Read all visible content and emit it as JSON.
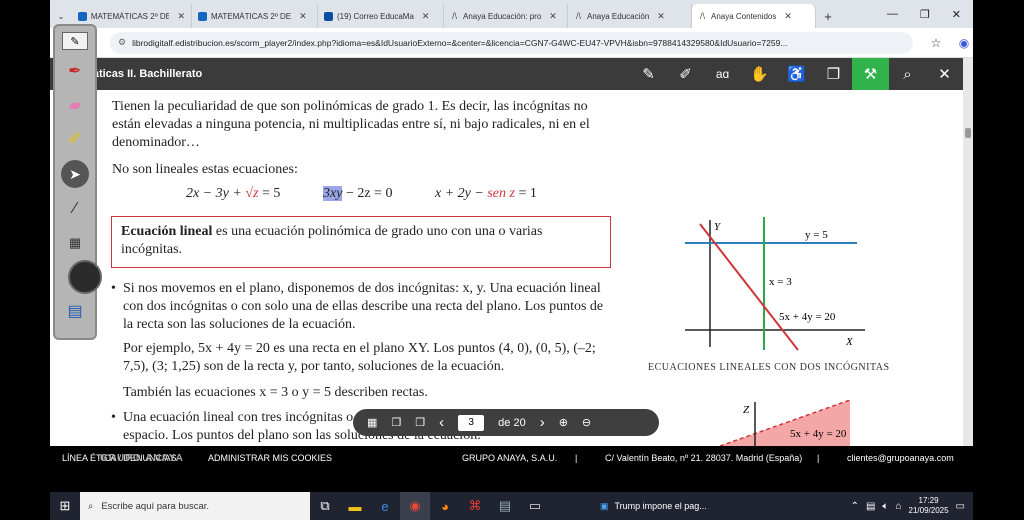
{
  "tabs": [
    {
      "label": "MATEMÁTICAS 2º DE",
      "icon": "hat-icon",
      "active": false
    },
    {
      "label": "MATEMÁTICAS 2º DE",
      "icon": "hat-icon",
      "active": false
    },
    {
      "label": "(19) Correo EducaMa",
      "icon": "mail-icon",
      "active": false
    },
    {
      "label": "Anaya Educación: pro",
      "icon": "anaya-icon",
      "active": false
    },
    {
      "label": "Anaya Educación",
      "icon": "anaya-icon",
      "active": false
    },
    {
      "label": "Anaya Contenidos",
      "icon": "anaya-icon",
      "active": true
    }
  ],
  "address": {
    "url": "librodigitalf.edistribucion.es/scorm_player2/index.php?idioma=es&IdUsuarioExterno=&center=&licencia=CGN7-G4WC-EU47-VPVH&isbn=9788414329580&IdUsuario=7259..."
  },
  "reader": {
    "title": "Matemáticas II. Bachillerato",
    "tools": [
      "pencil-icon",
      "marker-icon",
      "text-size-icon",
      "hand-icon",
      "accessibility-icon",
      "book-icon",
      "wrench-icon",
      "search-icon",
      "close-icon"
    ],
    "tool_text_size": "aɑ"
  },
  "content": {
    "para1": "Tienen la peculiaridad de que son polinómicas de grado 1. Es decir, las incógnitas no están elevadas a ninguna potencia, ni multiplicadas entre sí, ni bajo radicales, ni en el denominador…",
    "para2": "No son lineales estas ecuaciones:",
    "eq1_a": "2x − 3y + ",
    "eq1_red": "√z",
    "eq1_b": " = 5",
    "eq2_hl": "3xy",
    "eq2_b": " − 2z = 0",
    "eq3_a": "x + 2y − ",
    "eq3_red": "sen z",
    "eq3_b": " = 1",
    "def_term": "Ecuación lineal",
    "def_text": " es una ecuación polinómica de grado uno con una o varias incógnitas.",
    "bullet1": "Si nos movemos en el plano, disponemos de dos incógnitas:  x,  y.  Una ecuación lineal con dos incógnitas o con solo una de ellas describe una recta del plano. Los puntos de la recta son las soluciones de la ecuación.",
    "para3": "Por ejemplo,  5x + 4y = 20  es una recta en el plano  XY.  Los puntos (4, 0), (0, 5), (–2; 7,5), (3; 1,25) son de la recta y, por tanto, soluciones de la ecuación.",
    "para4": "También las ecuaciones  x = 3  o  y = 5  describen rectas.",
    "bullet2": "Una ecuación lineal con tres incógnitas o con alguna de ellas representa un plano en el espacio. Los puntos del plano son las soluciones de la ecuación.",
    "bullet_mark": "•",
    "caption": "Ecuaciones lineales con dos incógnitas",
    "graph": {
      "y_axis": "Y",
      "x_axis": "X",
      "label_y5": "y = 5",
      "label_x3": "x = 3",
      "label_line": "5x + 4y = 20"
    },
    "graph2": {
      "z_axis": "Z",
      "label_plane": "5x + 4y = 20"
    }
  },
  "pager": {
    "page": "3",
    "of_label": "de 20"
  },
  "footer": {
    "ethics": "LÍNEA ÉTICA / DENUNCIAS",
    "cookies": "ADMINISTRAR MIS COOKIES",
    "group": "GRUPO ANAYA, S.A.U.",
    "sep": "|",
    "address": "C/ Valentín Beato, nº 21. 28037. Madrid (España)",
    "email": "clientes@grupoanaya.com",
    "logo": "GRUPO ANAYA"
  },
  "taskbar": {
    "search_placeholder": "Escribe aquí para buscar.",
    "news": "Trump impone el pag...",
    "time": "17:29",
    "date": "21/09/2025"
  },
  "colors": {
    "toolbar": "#3b3b3b",
    "accent_green": "#2fb34a",
    "red": "#d0343a",
    "blue_line": "#2c7fb8"
  }
}
